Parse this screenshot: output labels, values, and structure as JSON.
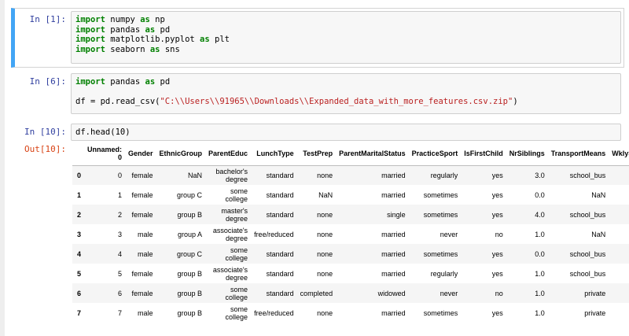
{
  "cells": [
    {
      "prompt": "In [1]:",
      "lines": [
        [
          {
            "t": "import",
            "c": "kw"
          },
          {
            "t": " numpy ",
            "c": ""
          },
          {
            "t": "as",
            "c": "kw"
          },
          {
            "t": " np",
            "c": ""
          }
        ],
        [
          {
            "t": "import",
            "c": "kw"
          },
          {
            "t": " pandas ",
            "c": ""
          },
          {
            "t": "as",
            "c": "kw"
          },
          {
            "t": " pd",
            "c": ""
          }
        ],
        [
          {
            "t": "import",
            "c": "kw"
          },
          {
            "t": " matplotlib.pyplot ",
            "c": ""
          },
          {
            "t": "as",
            "c": "kw"
          },
          {
            "t": " plt",
            "c": ""
          }
        ],
        [
          {
            "t": "import",
            "c": "kw"
          },
          {
            "t": " seaborn ",
            "c": ""
          },
          {
            "t": "as",
            "c": "kw"
          },
          {
            "t": " sns",
            "c": ""
          }
        ]
      ]
    },
    {
      "prompt": "In [6]:",
      "lines": [
        [
          {
            "t": "import",
            "c": "kw"
          },
          {
            "t": " pandas ",
            "c": ""
          },
          {
            "t": "as",
            "c": "kw"
          },
          {
            "t": " pd",
            "c": ""
          }
        ],
        [],
        [
          {
            "t": "df = pd.read_csv(",
            "c": ""
          },
          {
            "t": "\"C:\\\\Users\\\\91965\\\\Downloads\\\\Expanded_data_with_more_features.csv.zip\"",
            "c": "str"
          },
          {
            "t": ")",
            "c": ""
          }
        ]
      ]
    },
    {
      "prompt": "In [10]:",
      "lines": [
        [
          {
            "t": "df.head(10)",
            "c": ""
          }
        ]
      ]
    }
  ],
  "output_prompt": "Out[10]:",
  "table": {
    "columns": [
      "",
      "Unnamed: 0",
      "Gender",
      "EthnicGroup",
      "ParentEduc",
      "LunchType",
      "TestPrep",
      "ParentMaritalStatus",
      "PracticeSport",
      "IsFirstChild",
      "NrSiblings",
      "TransportMeans",
      "WklyStudy"
    ],
    "rows": [
      [
        "0",
        "0",
        "female",
        "NaN",
        "bachelor's degree",
        "standard",
        "none",
        "married",
        "regularly",
        "yes",
        "3.0",
        "school_bus",
        ""
      ],
      [
        "1",
        "1",
        "female",
        "group C",
        "some college",
        "standard",
        "NaN",
        "married",
        "sometimes",
        "yes",
        "0.0",
        "NaN",
        ""
      ],
      [
        "2",
        "2",
        "female",
        "group B",
        "master's degree",
        "standard",
        "none",
        "single",
        "sometimes",
        "yes",
        "4.0",
        "school_bus",
        ""
      ],
      [
        "3",
        "3",
        "male",
        "group A",
        "associate's degree",
        "free/reduced",
        "none",
        "married",
        "never",
        "no",
        "1.0",
        "NaN",
        ""
      ],
      [
        "4",
        "4",
        "male",
        "group C",
        "some college",
        "standard",
        "none",
        "married",
        "sometimes",
        "yes",
        "0.0",
        "school_bus",
        ""
      ],
      [
        "5",
        "5",
        "female",
        "group B",
        "associate's degree",
        "standard",
        "none",
        "married",
        "regularly",
        "yes",
        "1.0",
        "school_bus",
        ""
      ],
      [
        "6",
        "6",
        "female",
        "group B",
        "some college",
        "standard",
        "completed",
        "widowed",
        "never",
        "no",
        "1.0",
        "private",
        ""
      ],
      [
        "7",
        "7",
        "male",
        "group B",
        "some college",
        "free/reduced",
        "none",
        "married",
        "sometimes",
        "yes",
        "1.0",
        "private",
        ""
      ]
    ]
  }
}
